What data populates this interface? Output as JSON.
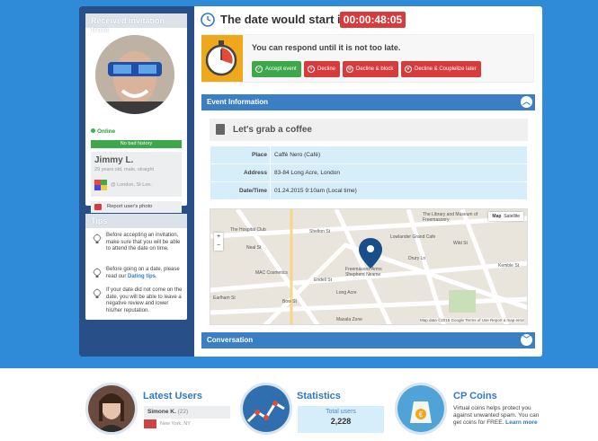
{
  "sidebar": {
    "received_title": "Received invitation from",
    "online_label": "Online",
    "history_badge": "No bad history",
    "user_name": "Jimmy L.",
    "user_info": "29 years old, male, straight",
    "user_location": "London, St Lon.",
    "report_label": "Report user's photo",
    "tips_title": "Tips",
    "tips": [
      {
        "text": "Before accepting an invitation, make sure that you will be able to attend the date on time."
      },
      {
        "text": "Before going on a date, please read our ",
        "link": "Dating tips",
        "after": "."
      },
      {
        "text": "If your date did not come on the date, you will be able to leave a negative review and lower his/her reputation."
      }
    ]
  },
  "header": {
    "title": "The date would start in:",
    "timer": "00:00:48:05"
  },
  "respond": {
    "message": "You can respond until it is not too late.",
    "buttons": {
      "accept": "Accept event",
      "decline": "Decline",
      "decline_block": "Decline & block",
      "decline_coupleize": "Decline & Couplelize later"
    }
  },
  "event": {
    "section_title": "Event Information",
    "name": "Let's grab a coffee",
    "rows": [
      {
        "key": "Place",
        "value": "Caffè Nero (Café)"
      },
      {
        "key": "Address",
        "value": "83-84 Long Acre, London"
      },
      {
        "key": "Date/Time",
        "value": "01.24.2015 9:10am (Local time)"
      }
    ]
  },
  "map": {
    "type_map": "Map",
    "type_satellite": "Satellite",
    "labels": [
      "The Hospital Club",
      "The Library and Museum of Freemasonry",
      "Lowlander Grand Cafe",
      "Freemasons Arms Shepherd Neame",
      "MAC Cosmetics",
      "Wild St",
      "Drury Ln",
      "Long Acre",
      "Endell St",
      "Shelton St",
      "Earlham St",
      "Masala Zone",
      "Kemble St",
      "Bow St",
      "Neal St"
    ],
    "zoom_in": "+",
    "zoom_out": "−",
    "attribution": "Map data ©2015 Google   Terms of Use   Report a map error"
  },
  "conversation": {
    "section_title": "Conversation"
  },
  "footer": {
    "latest_title": "Latest Users",
    "latest_user": "Simone K.",
    "latest_user_age": "(22)",
    "latest_user_loc": "New York, NY",
    "stats_title": "Statistics",
    "stats_label": "Total users",
    "stats_value": "2,228",
    "coins_title": "CP Coins",
    "coins_text": "Virtual coins helps protect you against unwanted spam. You can get coins for FREE.",
    "coins_link": "Learn more"
  },
  "colors": {
    "background": "#2f8bd8",
    "sidebar": "#294f88",
    "accept": "#3ca84a",
    "decline": "#d83b3b",
    "section": "#3a7fc4"
  }
}
